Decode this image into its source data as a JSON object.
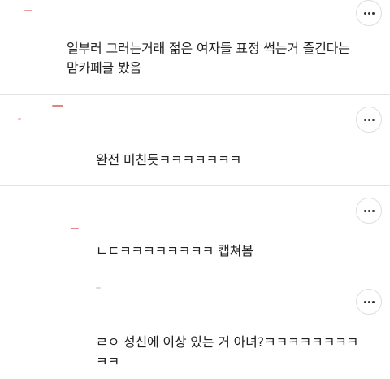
{
  "comments": [
    {
      "text": "일부러 그러는거래 젊은 여자들 표정 썩는거 즐긴다는\n맘카페글 봤음",
      "more_icon": "more-horizontal-icon",
      "accent_color": "#d94a4a"
    },
    {
      "text": "완전 미친듯ㅋㅋㅋㅋㅋㅋㅋ",
      "more_icon": "more-horizontal-icon",
      "accent_color": "#c0392b"
    },
    {
      "text": "ㄴㄷㅋㅋㅋㅋㅋㅋㅋㅋ 캡쳐봄",
      "more_icon": "more-horizontal-icon",
      "accent_color": "#e0506a"
    },
    {
      "text": "ㄹㅇ 성신에 이상 있는 거 아녀?ㅋㅋㅋㅋㅋㅋㅋㅋ\nㅋㅋ",
      "more_icon": "more-horizontal-icon",
      "accent_color": "#bbbbbb"
    }
  ],
  "colors": {
    "background": "#ffffff",
    "divider": "#e4e4e4",
    "text": "#222222",
    "button_border": "#dedede"
  }
}
